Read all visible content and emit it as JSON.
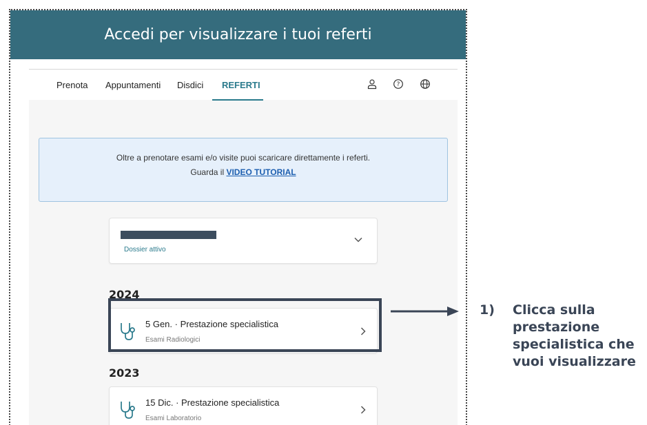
{
  "banner": {
    "title": "Accedi per visualizzare i tuoi referti"
  },
  "nav": {
    "tabs": [
      {
        "label": "Prenota"
      },
      {
        "label": "Appuntamenti"
      },
      {
        "label": "Disdici"
      },
      {
        "label": "REFERTI",
        "active": true
      }
    ],
    "icons": [
      "user-icon",
      "help-icon",
      "globe-icon"
    ]
  },
  "info": {
    "line1": "Oltre a prenotare esami e/o visite puoi scaricare direttamente i referti.",
    "line2_prefix": "Guarda il ",
    "link": "VIDEO TUTORIAL"
  },
  "dossier": {
    "status": "Dossier attivo"
  },
  "groups": [
    {
      "year": "2024",
      "items": [
        {
          "title": "5 Gen. · Prestazione specialistica",
          "subtitle": "Esami Radiologici"
        }
      ]
    },
    {
      "year": "2023",
      "items": [
        {
          "title": "15 Dic. · Prestazione specialistica",
          "subtitle": "Esami Laboratorio"
        }
      ]
    }
  ],
  "annotation": {
    "number": "1)",
    "text": "Clicca sulla prestazione specialistica che vuoi visualizzare"
  },
  "colors": {
    "banner": "#356c7d",
    "accent": "#2a7a8c",
    "callout": "#3a4556",
    "info_bg": "#e6f0fb"
  }
}
